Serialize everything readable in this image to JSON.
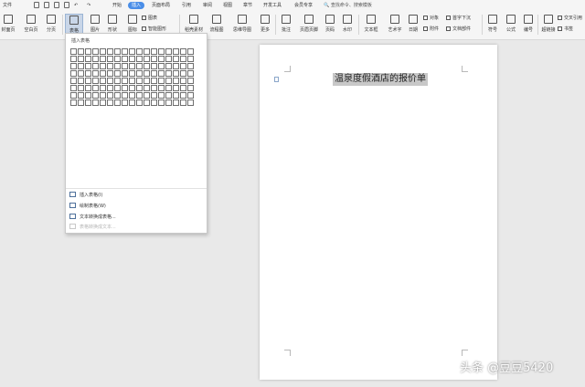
{
  "menubar": {
    "file": "文件",
    "tabs": [
      "开始",
      "插入",
      "页面布局",
      "引用",
      "审阅",
      "视图",
      "章节",
      "开发工具",
      "会员专享"
    ],
    "active_tab_index": 1,
    "search_placeholder": "查找命令、搜索模板"
  },
  "ribbon": {
    "buttons": [
      "封面页",
      "空白页",
      "分页",
      "表格",
      "图片",
      "形状",
      "图标",
      "稻壳素材",
      "流程图",
      "思维导图",
      "更多",
      "批注",
      "页眉页脚",
      "页码",
      "水印",
      "文本框",
      "艺术字",
      "日期",
      "附件",
      "文档部件",
      "符号",
      "公式",
      "编号",
      "超链接",
      "书签"
    ],
    "small": [
      "图表",
      "智能图形",
      "对象",
      "首字下沉",
      "交叉引用"
    ]
  },
  "dropdown": {
    "header": "插入表格",
    "grid_rows": 8,
    "grid_cols": 17,
    "items": [
      {
        "label": "插入表格(I)",
        "disabled": false
      },
      {
        "label": "绘制表格(W)",
        "disabled": false
      },
      {
        "label": "文本转换成表格...",
        "disabled": false
      },
      {
        "label": "表格转换成文本...",
        "disabled": true
      }
    ]
  },
  "document": {
    "title": "温泉度假酒店的报价单"
  },
  "watermark": "头条 @豆豆5420",
  "colors": {
    "accent": "#4a8ee8",
    "ribbon_bg": "#f5f5f5",
    "canvas_bg": "#e9e9e9"
  }
}
